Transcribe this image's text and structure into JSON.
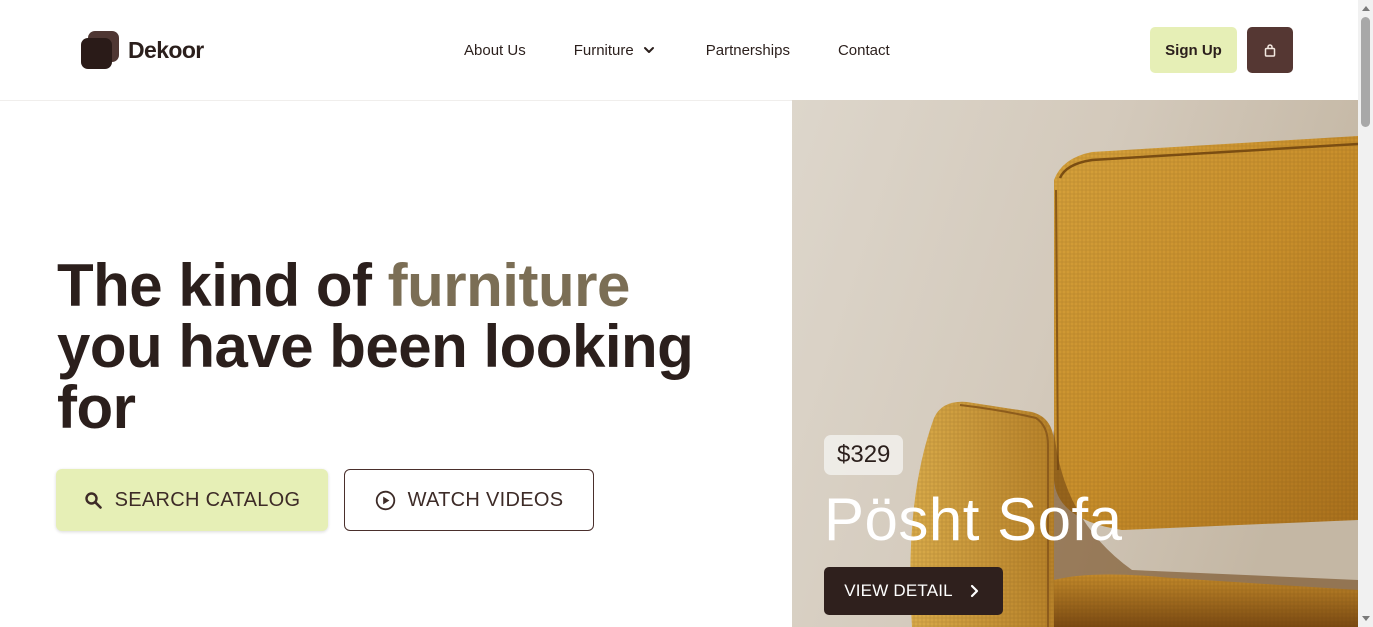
{
  "brand": {
    "name": "Dekoor",
    "logo_icon": "stacked-squares-logo"
  },
  "nav": {
    "items": [
      {
        "label": "About Us"
      },
      {
        "label": "Furniture",
        "has_dropdown": true,
        "icon": "chevron-down-icon"
      },
      {
        "label": "Partnerships"
      },
      {
        "label": "Contact"
      }
    ]
  },
  "header": {
    "signup_label": "Sign Up",
    "cart_icon": "shopping-bag-icon"
  },
  "hero": {
    "headline_part1": "The kind of ",
    "headline_accent": "furniture",
    "headline_part2": "you have been looking for",
    "search_button": {
      "label": "SEARCH CATALOG",
      "icon": "search-icon"
    },
    "watch_button": {
      "label": "WATCH VIDEOS",
      "icon": "play-circle-icon"
    }
  },
  "product": {
    "price": "$329",
    "name": "Pösht Sofa",
    "cta_label": "VIEW DETAIL",
    "cta_icon": "chevron-right-icon"
  },
  "colors": {
    "text_dark": "#2b1f1c",
    "accent_text": "#7b6e55",
    "lime": "#e6efb6",
    "brown": "#553733",
    "dark_button": "#2f201d"
  }
}
